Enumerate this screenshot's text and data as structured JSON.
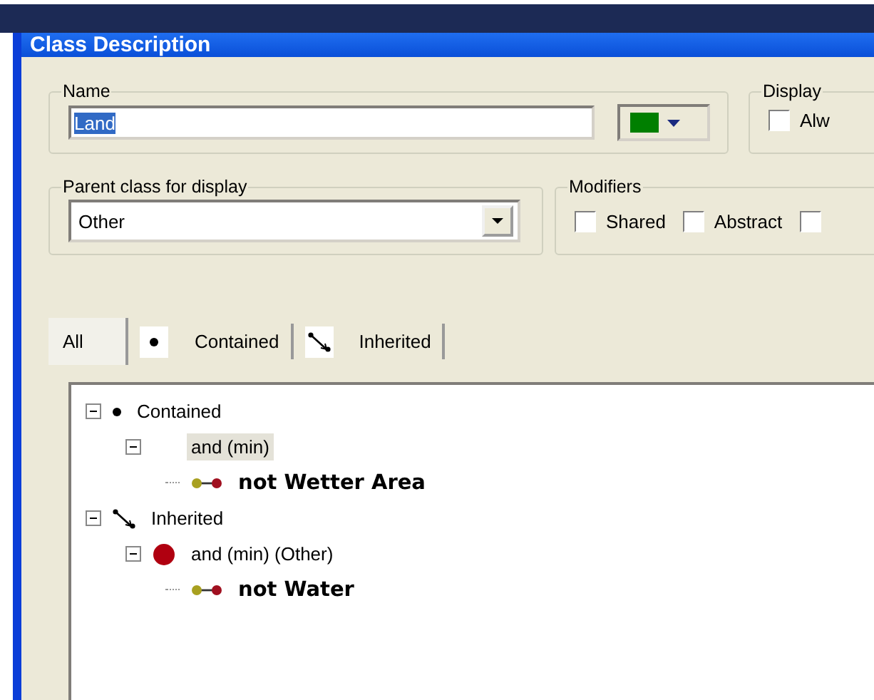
{
  "window": {
    "title": "Class Description"
  },
  "name_group": {
    "label": "Name",
    "value": "Land",
    "color": "#007f00"
  },
  "display_group": {
    "label": "Display",
    "checkbox": {
      "label": "Alw",
      "checked": false
    }
  },
  "parent_group": {
    "label": "Parent class for display",
    "value": "Other"
  },
  "modifiers": {
    "label": "Modifiers",
    "items": [
      {
        "label": "Shared",
        "checked": false
      },
      {
        "label": "Abstract",
        "checked": false
      },
      {
        "checked": false
      }
    ]
  },
  "tabs": [
    {
      "label": "All",
      "kind": "all",
      "selected": true
    },
    {
      "label": "Contained",
      "kind": "contained",
      "selected": false
    },
    {
      "label": "Inherited",
      "kind": "inherited",
      "selected": false
    }
  ],
  "tree": [
    {
      "label": "Contained",
      "kind": "contained",
      "expanded": true,
      "selected": false,
      "children": [
        {
          "label": "and (min)",
          "kind": "operator",
          "expanded": true,
          "selected": true,
          "children": [
            {
              "label": "not Wetter Area",
              "kind": "constraint",
              "selected": false
            }
          ]
        }
      ]
    },
    {
      "label": "Inherited",
      "kind": "inherited",
      "expanded": true,
      "selected": false,
      "children": [
        {
          "label": "and (min) (Other)",
          "kind": "inherited-operator",
          "expanded": true,
          "selected": false,
          "children": [
            {
              "label": "not Water",
              "kind": "constraint",
              "selected": false
            }
          ]
        }
      ]
    }
  ]
}
